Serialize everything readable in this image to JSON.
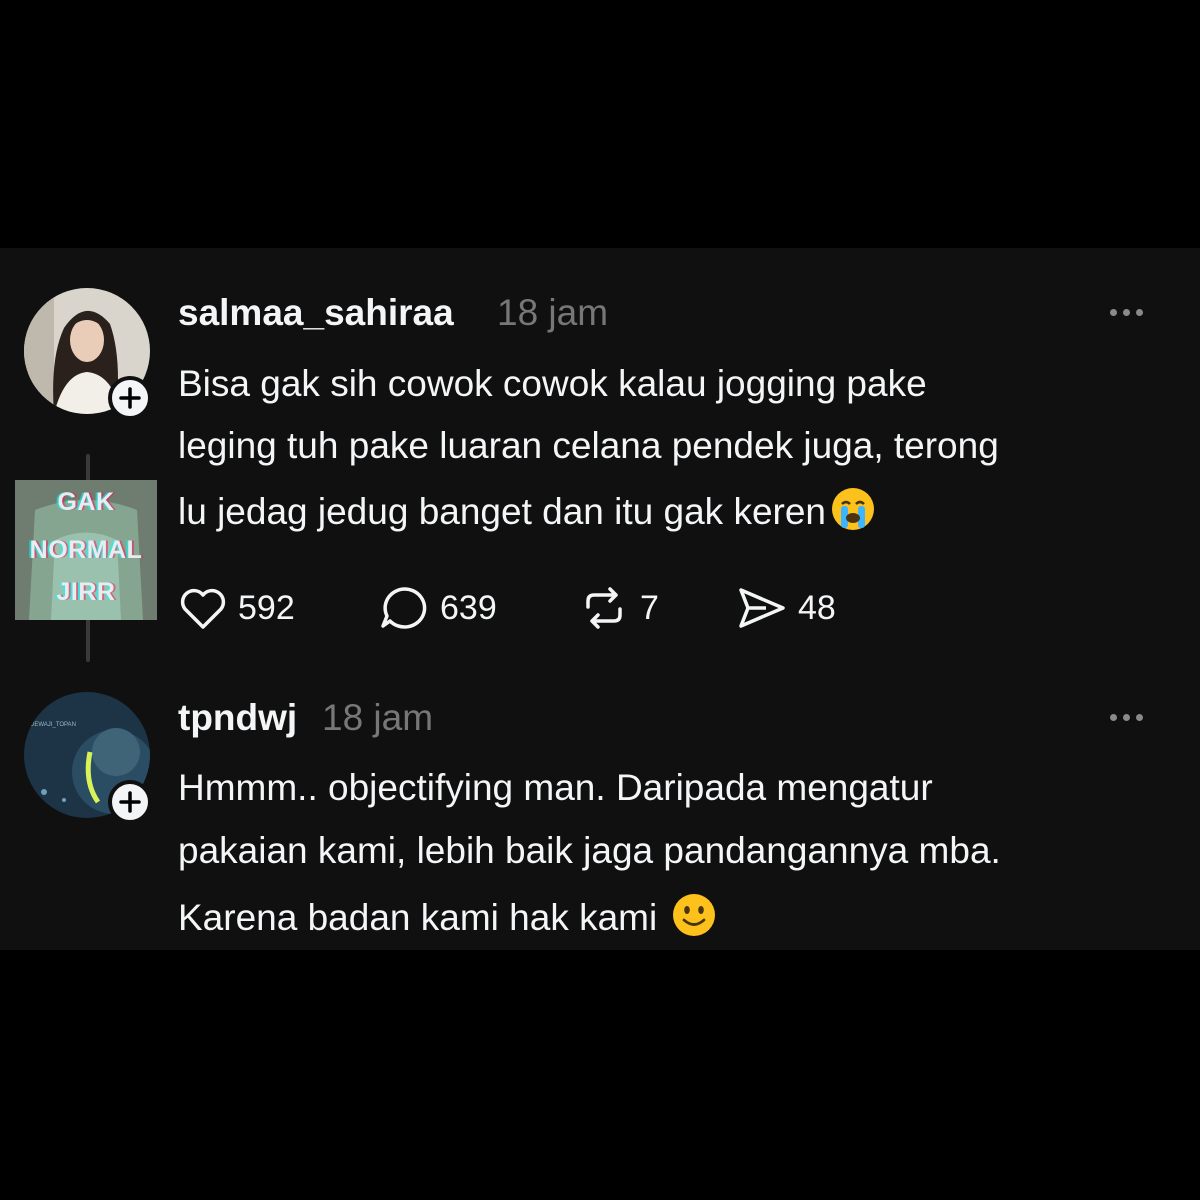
{
  "posts": [
    {
      "username": "salmaa_sahiraa",
      "time": "18 jam",
      "lines": [
        "Bisa gak sih cowok cowok kalau jogging pake",
        "leging tuh pake luaran celana pendek juga, terong",
        "lu jedag jedug banget  dan itu gak keren"
      ],
      "emoji": "loudly-crying-face",
      "actions": {
        "likes": "592",
        "comments": "639",
        "reposts": "7",
        "shares": "48"
      }
    },
    {
      "username": "tpndwj",
      "time": "18 jam",
      "lines": [
        "Hmmm.. objectifying man. Daripada mengatur",
        "pakaian kami, lebih baik jaga pandangannya mba.",
        "Karena badan kami hak kami"
      ],
      "emoji": "slightly-smiling-face"
    }
  ],
  "watermark": {
    "lines": [
      "GAK",
      "NORMAL",
      "JIRR"
    ]
  },
  "avatar2_caption": "DEWAJI_TOPAN",
  "colors": {
    "background": "#000000",
    "card": "#101010",
    "text": "#f3f5f7",
    "muted": "#777777"
  }
}
